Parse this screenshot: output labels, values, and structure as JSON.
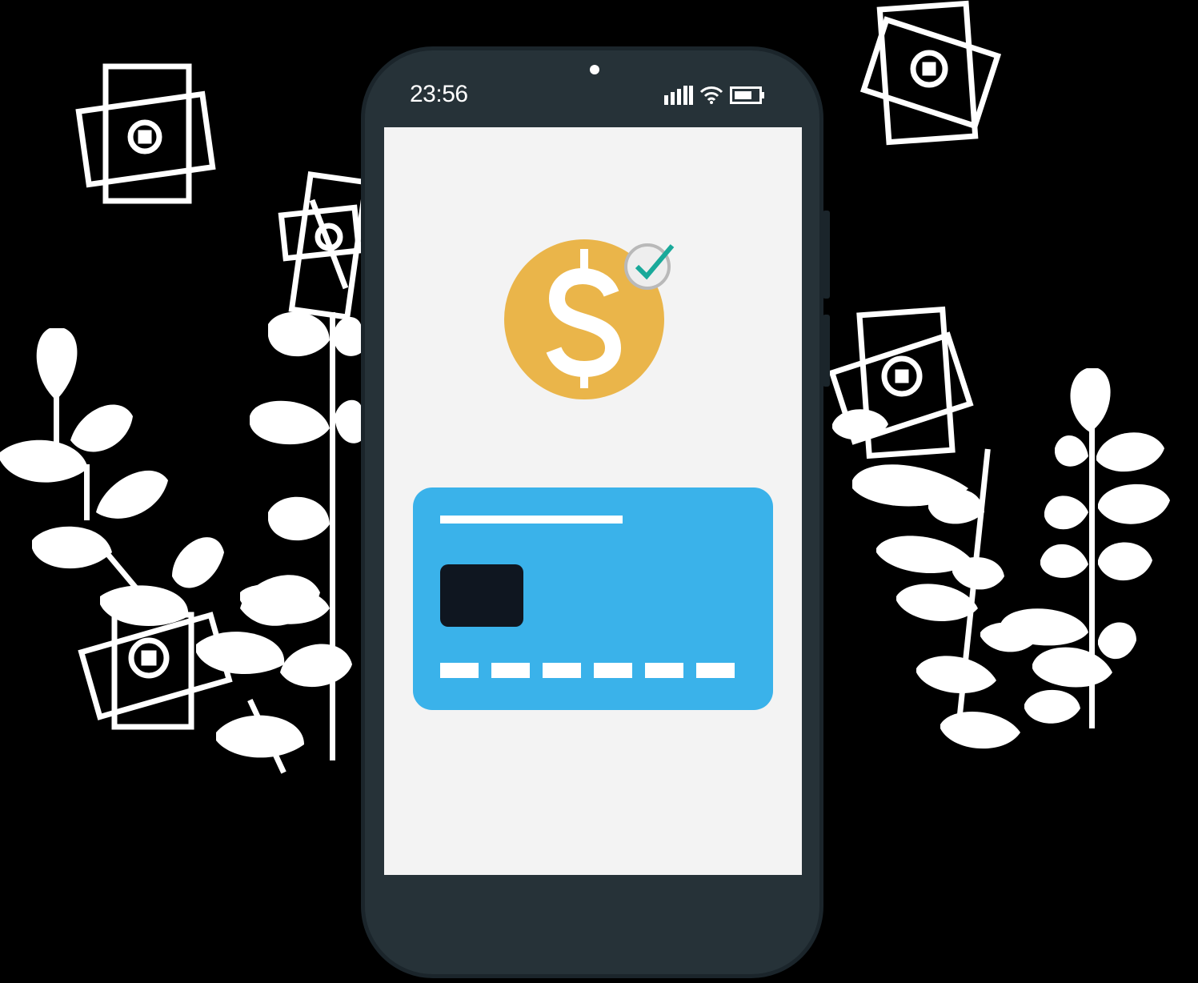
{
  "status_bar": {
    "time": "23:56",
    "icons": [
      "signal-icon",
      "wifi-icon",
      "battery-icon"
    ]
  },
  "screen": {
    "payment_icon": "dollar-coin-icon",
    "confirmation_icon": "check-icon",
    "card_icon": "credit-card-icon"
  },
  "colors": {
    "background": "#000000",
    "phone_body": "#263238",
    "screen": "#f3f3f3",
    "coin": "#eab54a",
    "check": "#19a99a",
    "card": "#3ab2ea",
    "chip": "#0f1620",
    "decoration": "#ffffff"
  }
}
